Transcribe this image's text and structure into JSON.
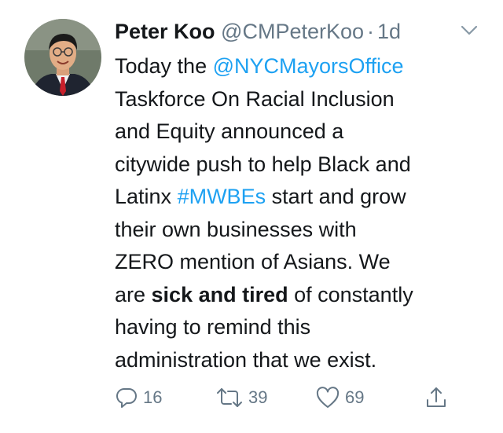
{
  "tweet": {
    "author": {
      "display_name": "Peter Koo",
      "handle": "@CMPeterKoo",
      "separator": "·",
      "time": "1d"
    },
    "body": {
      "line1": {
        "pre": "Today the ",
        "mention": "@NYCMayorsOffice"
      },
      "line2": "Taskforce On Racial Inclusion",
      "line3": "and Equity announced a",
      "line4": "citywide push to help Black and",
      "line5": {
        "pre": "Latinx ",
        "hashtag": "#MWBEs",
        "post": " start and grow"
      },
      "line6": "their own businesses with",
      "line7": "ZERO mention of Asians. We",
      "line8": {
        "pre": "are ",
        "bold": "sick and tired",
        "post": " of constantly"
      },
      "line9": "having to remind this",
      "line10": "administration that we exist."
    },
    "actions": {
      "reply_count": "16",
      "retweet_count": "39",
      "like_count": "69"
    }
  },
  "icons": {
    "avatar": "profile-photo",
    "caret": "chevron-down-icon",
    "reply": "reply-icon",
    "retweet": "retweet-icon",
    "like": "heart-icon",
    "share": "share-icon"
  },
  "colors": {
    "text": "#14171a",
    "secondary": "#657786",
    "link": "#1da1f2"
  }
}
